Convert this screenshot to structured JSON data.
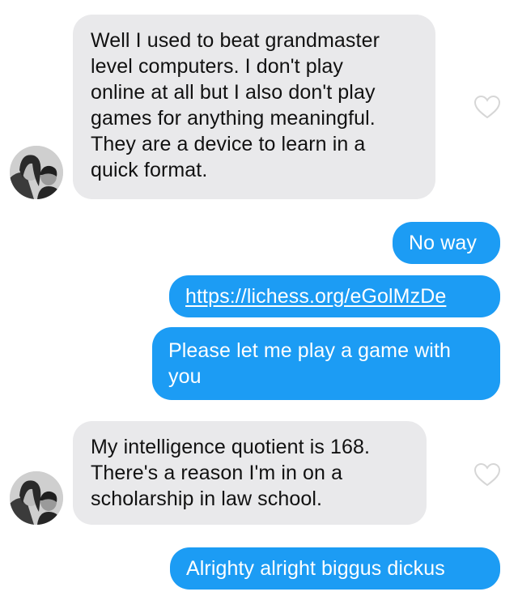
{
  "messages": [
    {
      "from": "them",
      "lines": [
        "Well I used to beat grandmaster",
        "level computers.  I don't play",
        "online at all but I also don't play",
        "games for anything meaningful.",
        "They are a device to learn in a",
        "quick format."
      ],
      "heart_icon": "heart-outline-icon"
    },
    {
      "from": "me",
      "text": "No way"
    },
    {
      "from": "me",
      "text": "https://lichess.org/eGolMzDe",
      "is_link": true
    },
    {
      "from": "me",
      "lines": [
        "Please let me play a game with",
        "you"
      ]
    },
    {
      "from": "them",
      "lines": [
        "My intelligence quotient is 168.",
        "There's a reason I'm in on a",
        "scholarship in law school."
      ],
      "heart_icon": "heart-outline-icon"
    },
    {
      "from": "me",
      "text": "Alrighty alright biggus dickus"
    }
  ],
  "colors": {
    "sent_bubble": "#1c9cf4",
    "received_bubble": "#e9e9eb",
    "heart_outline": "#d6d6d6"
  }
}
